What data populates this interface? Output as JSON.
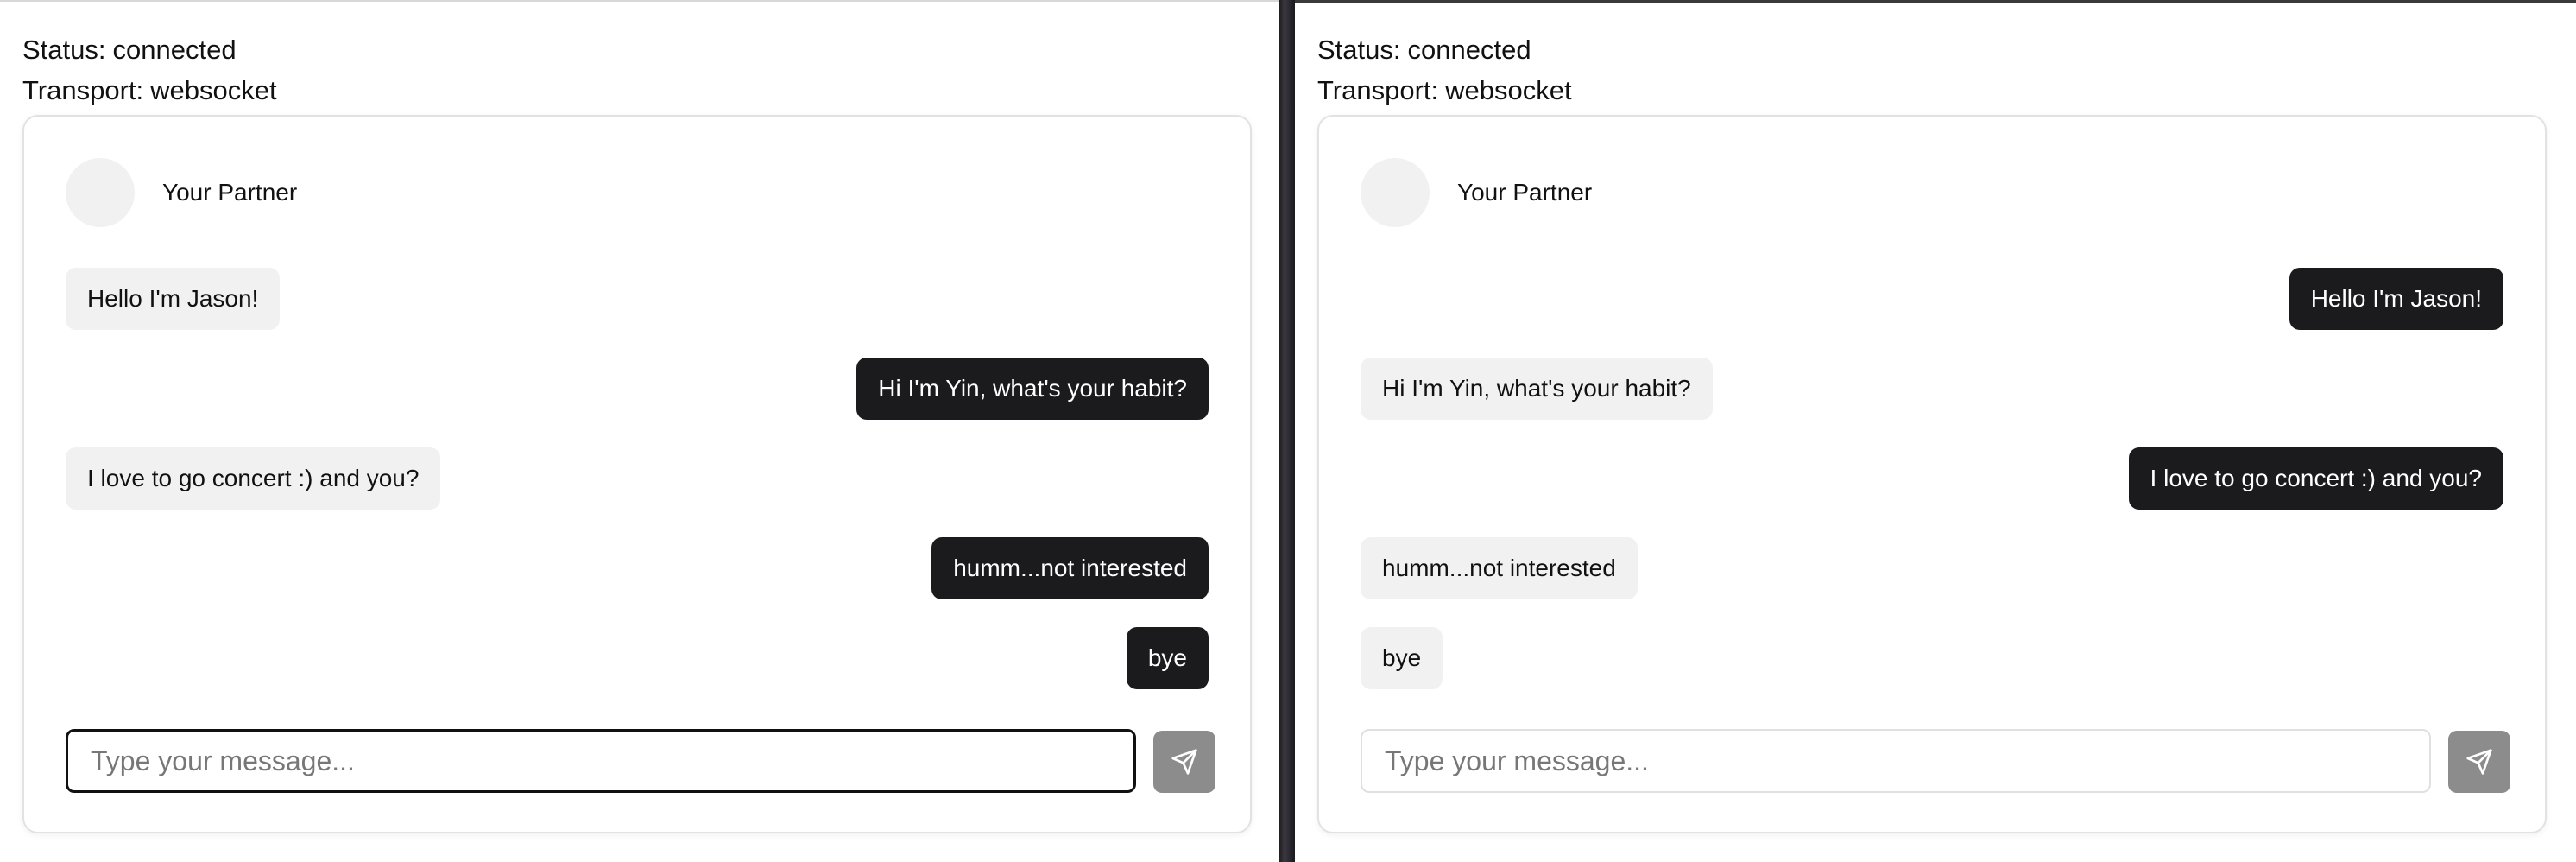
{
  "left": {
    "status_label": "Status:",
    "status_value": "connected",
    "transport_label": "Transport:",
    "transport_value": "websocket",
    "partner_name": "Your Partner",
    "messages": [
      {
        "text": "Hello I'm Jason!",
        "direction": "incoming"
      },
      {
        "text": "Hi I'm Yin, what's your habit?",
        "direction": "outgoing"
      },
      {
        "text": "I love to go concert :) and you?",
        "direction": "incoming"
      },
      {
        "text": "humm...not interested",
        "direction": "outgoing"
      },
      {
        "text": "bye",
        "direction": "outgoing"
      }
    ],
    "input_placeholder": "Type your message...",
    "input_value": "",
    "send_icon": "send-icon"
  },
  "right": {
    "status_label": "Status:",
    "status_value": "connected",
    "transport_label": "Transport:",
    "transport_value": "websocket",
    "partner_name": "Your Partner",
    "messages": [
      {
        "text": "Hello I'm Jason!",
        "direction": "outgoing"
      },
      {
        "text": "Hi I'm Yin, what's your habit?",
        "direction": "incoming"
      },
      {
        "text": "I love to go concert :) and you?",
        "direction": "outgoing"
      },
      {
        "text": "humm...not interested",
        "direction": "incoming"
      },
      {
        "text": "bye",
        "direction": "incoming"
      }
    ],
    "input_placeholder": "Type your message...",
    "input_value": "",
    "send_icon": "send-icon"
  },
  "colors": {
    "outgoing_bubble": "#1b1b1d",
    "incoming_bubble": "#f1f1f1",
    "send_button": "#8c8c8c"
  }
}
